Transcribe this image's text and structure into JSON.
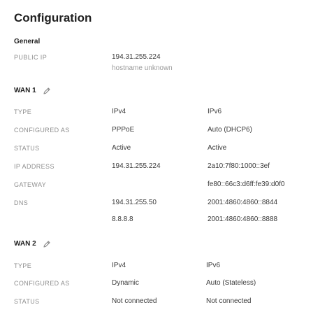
{
  "page": {
    "title": "Configuration"
  },
  "general": {
    "heading": "General",
    "public_ip": {
      "label": "PUBLIC IP",
      "value": "194.31.255.224",
      "hostname": "hostname unknown"
    }
  },
  "wan1": {
    "heading": "WAN 1",
    "rows": [
      {
        "label": "TYPE",
        "v4": "IPv4",
        "v6": "IPv6"
      },
      {
        "label": "CONFIGURED AS",
        "v4": "PPPoE",
        "v6": "Auto (DHCP6)"
      },
      {
        "label": "STATUS",
        "v4": "Active",
        "v6": "Active"
      },
      {
        "label": "IP ADDRESS",
        "v4": "194.31.255.224",
        "v6": "2a10:7f80:1000::3ef"
      },
      {
        "label": "GATEWAY",
        "v4": "",
        "v6": "fe80::66c3:d6ff:fe39:d0f0"
      },
      {
        "label": "DNS",
        "v4": "194.31.255.50",
        "v6": "2001:4860:4860::8844"
      },
      {
        "label": "",
        "v4": "8.8.8.8",
        "v6": "2001:4860:4860::8888"
      }
    ]
  },
  "wan2": {
    "heading": "WAN 2",
    "rows": [
      {
        "label": "TYPE",
        "v4": "IPv4",
        "v6": "IPv6"
      },
      {
        "label": "CONFIGURED AS",
        "v4": "Dynamic",
        "v6": "Auto (Stateless)"
      },
      {
        "label": "STATUS",
        "v4": "Not connected",
        "v6": "Not connected"
      }
    ]
  }
}
